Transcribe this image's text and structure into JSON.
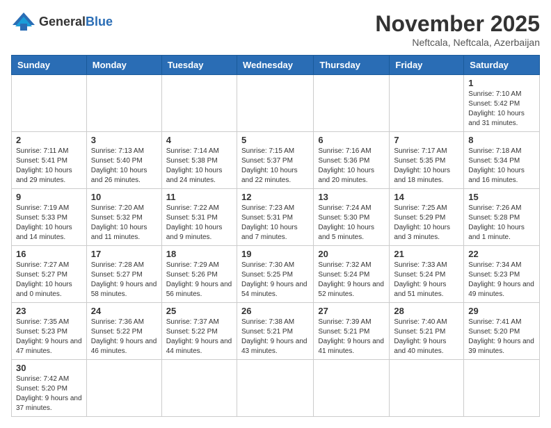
{
  "header": {
    "logo_general": "General",
    "logo_blue": "Blue",
    "month_year": "November 2025",
    "location": "Neftcala, Neftcala, Azerbaijan"
  },
  "days_of_week": [
    "Sunday",
    "Monday",
    "Tuesday",
    "Wednesday",
    "Thursday",
    "Friday",
    "Saturday"
  ],
  "weeks": [
    [
      {
        "day": "",
        "info": ""
      },
      {
        "day": "",
        "info": ""
      },
      {
        "day": "",
        "info": ""
      },
      {
        "day": "",
        "info": ""
      },
      {
        "day": "",
        "info": ""
      },
      {
        "day": "",
        "info": ""
      },
      {
        "day": "1",
        "info": "Sunrise: 7:10 AM\nSunset: 5:42 PM\nDaylight: 10 hours and 31 minutes."
      }
    ],
    [
      {
        "day": "2",
        "info": "Sunrise: 7:11 AM\nSunset: 5:41 PM\nDaylight: 10 hours and 29 minutes."
      },
      {
        "day": "3",
        "info": "Sunrise: 7:13 AM\nSunset: 5:40 PM\nDaylight: 10 hours and 26 minutes."
      },
      {
        "day": "4",
        "info": "Sunrise: 7:14 AM\nSunset: 5:38 PM\nDaylight: 10 hours and 24 minutes."
      },
      {
        "day": "5",
        "info": "Sunrise: 7:15 AM\nSunset: 5:37 PM\nDaylight: 10 hours and 22 minutes."
      },
      {
        "day": "6",
        "info": "Sunrise: 7:16 AM\nSunset: 5:36 PM\nDaylight: 10 hours and 20 minutes."
      },
      {
        "day": "7",
        "info": "Sunrise: 7:17 AM\nSunset: 5:35 PM\nDaylight: 10 hours and 18 minutes."
      },
      {
        "day": "8",
        "info": "Sunrise: 7:18 AM\nSunset: 5:34 PM\nDaylight: 10 hours and 16 minutes."
      }
    ],
    [
      {
        "day": "9",
        "info": "Sunrise: 7:19 AM\nSunset: 5:33 PM\nDaylight: 10 hours and 14 minutes."
      },
      {
        "day": "10",
        "info": "Sunrise: 7:20 AM\nSunset: 5:32 PM\nDaylight: 10 hours and 11 minutes."
      },
      {
        "day": "11",
        "info": "Sunrise: 7:22 AM\nSunset: 5:31 PM\nDaylight: 10 hours and 9 minutes."
      },
      {
        "day": "12",
        "info": "Sunrise: 7:23 AM\nSunset: 5:31 PM\nDaylight: 10 hours and 7 minutes."
      },
      {
        "day": "13",
        "info": "Sunrise: 7:24 AM\nSunset: 5:30 PM\nDaylight: 10 hours and 5 minutes."
      },
      {
        "day": "14",
        "info": "Sunrise: 7:25 AM\nSunset: 5:29 PM\nDaylight: 10 hours and 3 minutes."
      },
      {
        "day": "15",
        "info": "Sunrise: 7:26 AM\nSunset: 5:28 PM\nDaylight: 10 hours and 1 minute."
      }
    ],
    [
      {
        "day": "16",
        "info": "Sunrise: 7:27 AM\nSunset: 5:27 PM\nDaylight: 10 hours and 0 minutes."
      },
      {
        "day": "17",
        "info": "Sunrise: 7:28 AM\nSunset: 5:27 PM\nDaylight: 9 hours and 58 minutes."
      },
      {
        "day": "18",
        "info": "Sunrise: 7:29 AM\nSunset: 5:26 PM\nDaylight: 9 hours and 56 minutes."
      },
      {
        "day": "19",
        "info": "Sunrise: 7:30 AM\nSunset: 5:25 PM\nDaylight: 9 hours and 54 minutes."
      },
      {
        "day": "20",
        "info": "Sunrise: 7:32 AM\nSunset: 5:24 PM\nDaylight: 9 hours and 52 minutes."
      },
      {
        "day": "21",
        "info": "Sunrise: 7:33 AM\nSunset: 5:24 PM\nDaylight: 9 hours and 51 minutes."
      },
      {
        "day": "22",
        "info": "Sunrise: 7:34 AM\nSunset: 5:23 PM\nDaylight: 9 hours and 49 minutes."
      }
    ],
    [
      {
        "day": "23",
        "info": "Sunrise: 7:35 AM\nSunset: 5:23 PM\nDaylight: 9 hours and 47 minutes."
      },
      {
        "day": "24",
        "info": "Sunrise: 7:36 AM\nSunset: 5:22 PM\nDaylight: 9 hours and 46 minutes."
      },
      {
        "day": "25",
        "info": "Sunrise: 7:37 AM\nSunset: 5:22 PM\nDaylight: 9 hours and 44 minutes."
      },
      {
        "day": "26",
        "info": "Sunrise: 7:38 AM\nSunset: 5:21 PM\nDaylight: 9 hours and 43 minutes."
      },
      {
        "day": "27",
        "info": "Sunrise: 7:39 AM\nSunset: 5:21 PM\nDaylight: 9 hours and 41 minutes."
      },
      {
        "day": "28",
        "info": "Sunrise: 7:40 AM\nSunset: 5:21 PM\nDaylight: 9 hours and 40 minutes."
      },
      {
        "day": "29",
        "info": "Sunrise: 7:41 AM\nSunset: 5:20 PM\nDaylight: 9 hours and 39 minutes."
      }
    ],
    [
      {
        "day": "30",
        "info": "Sunrise: 7:42 AM\nSunset: 5:20 PM\nDaylight: 9 hours and 37 minutes."
      },
      {
        "day": "",
        "info": ""
      },
      {
        "day": "",
        "info": ""
      },
      {
        "day": "",
        "info": ""
      },
      {
        "day": "",
        "info": ""
      },
      {
        "day": "",
        "info": ""
      },
      {
        "day": "",
        "info": ""
      }
    ]
  ]
}
